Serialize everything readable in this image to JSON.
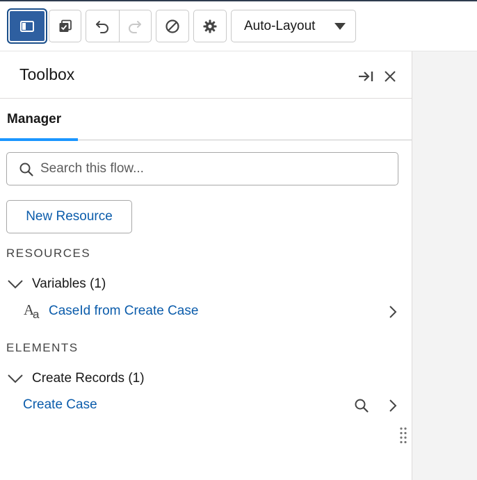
{
  "toolbar": {
    "toggle_icon": "panel-toggle-icon",
    "copy_icon": "copy-check-icon",
    "undo_icon": "undo-icon",
    "redo_icon": "redo-icon",
    "block_icon": "ban-icon",
    "settings_icon": "gear-icon",
    "layout_select": {
      "value": "Auto-Layout",
      "icon": "caret-down-icon"
    }
  },
  "panel": {
    "title": "Toolbox",
    "collapse_icon": "collapse-right-icon",
    "close_icon": "close-icon",
    "tabs": [
      {
        "label": "Manager",
        "active": true
      }
    ],
    "search": {
      "placeholder": "Search this flow...",
      "value": ""
    },
    "new_resource_label": "New Resource",
    "sections": [
      {
        "label": "RESOURCES",
        "groups": [
          {
            "label": "Variables (1)",
            "expanded": true,
            "items": [
              {
                "label": "CaseId from Create Case",
                "icon": "text-type-icon"
              }
            ]
          }
        ]
      },
      {
        "label": "ELEMENTS",
        "groups": [
          {
            "label": "Create Records (1)",
            "expanded": true,
            "items": [
              {
                "label": "Create Case"
              }
            ]
          }
        ]
      }
    ]
  },
  "colors": {
    "accent": "#1b96ff",
    "link": "#0b5cab",
    "active_button": "#2e5fa0",
    "canvas": "#f3f3f3"
  }
}
